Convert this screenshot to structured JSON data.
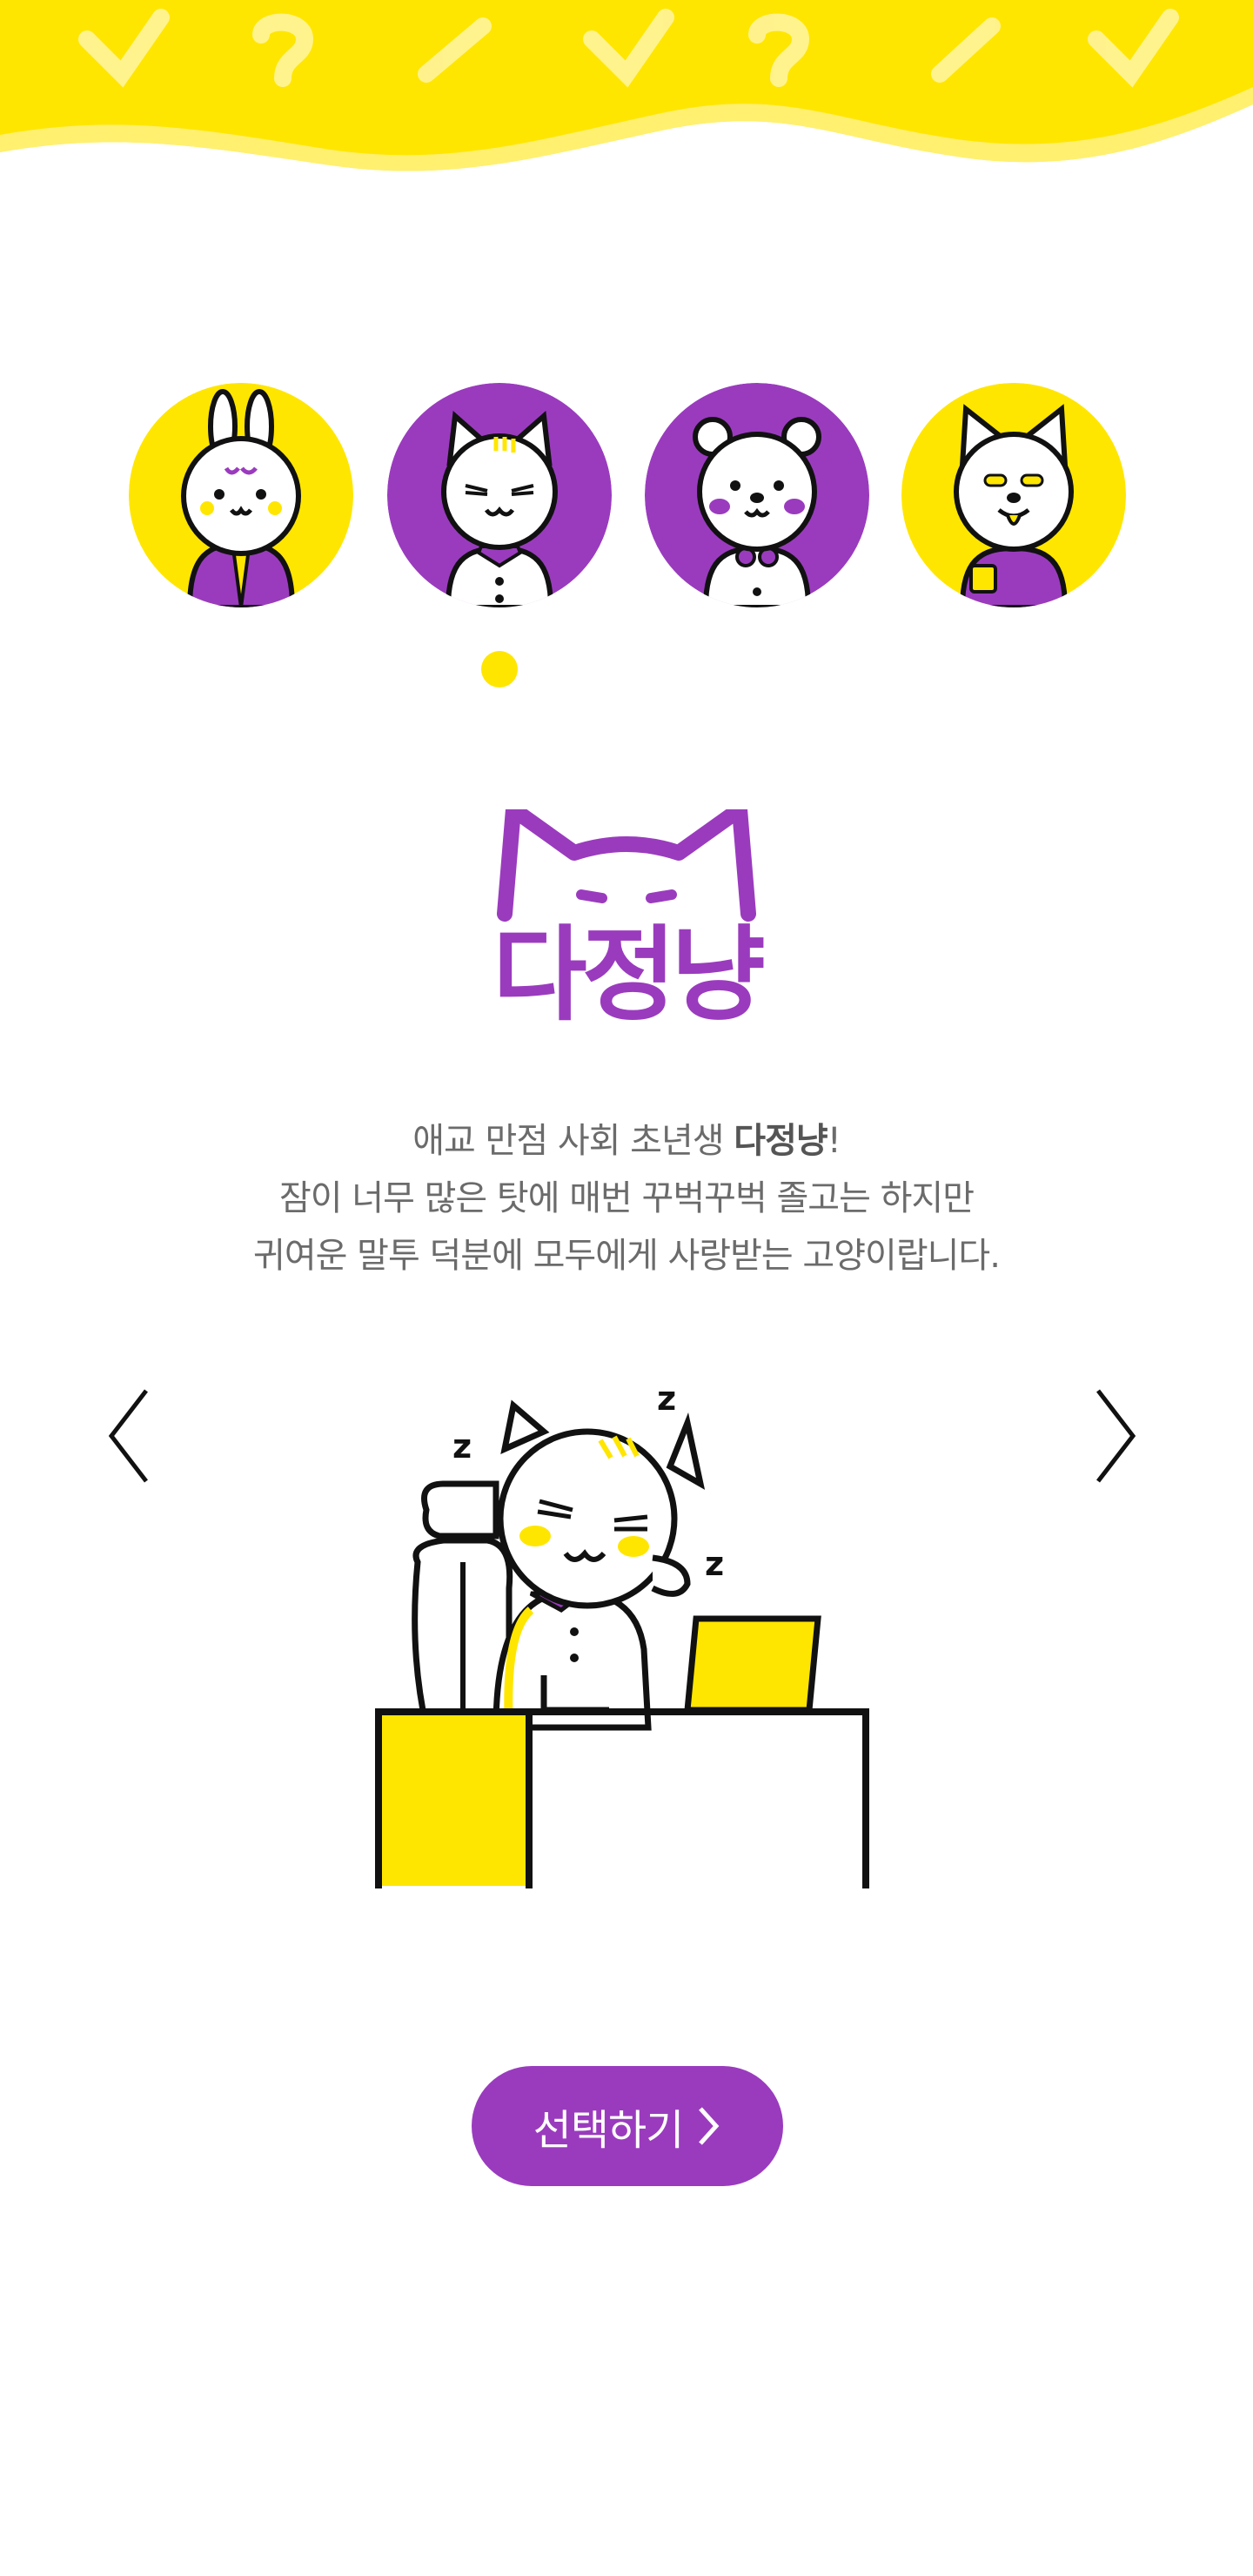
{
  "colors": {
    "yellow": "#FFE600",
    "purple": "#9A3BBE",
    "text_gray": "#6b6b6b"
  },
  "characters": [
    {
      "name": "rabbit",
      "bg": "#FFE600",
      "selected": false
    },
    {
      "name": "cat",
      "bg": "#9A3BBE",
      "selected": true
    },
    {
      "name": "bear",
      "bg": "#9A3BBE",
      "selected": false
    },
    {
      "name": "dog",
      "bg": "#FFE600",
      "selected": false
    }
  ],
  "selected_character": {
    "title": "다정냥",
    "description": {
      "line1_prefix": "애교 만점 사회 초년생 ",
      "line1_bold": "다정냥",
      "line1_suffix": "!",
      "line2": "잠이 너무 많은 탓에 매번 꾸벅꾸벅 졸고는 하지만",
      "line3": "귀여운 말투 덕분에 모두에게 사랑받는 고양이랍니다."
    }
  },
  "navigation": {
    "prev_icon": "chevron-left-icon",
    "next_icon": "chevron-right-icon"
  },
  "select_button": {
    "label": "선택하기",
    "icon": "chevron-right-icon"
  }
}
